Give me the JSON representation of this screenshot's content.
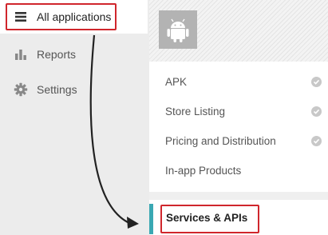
{
  "sidebar": {
    "all_applications": {
      "label": "All applications",
      "icon": "menu-icon"
    },
    "reports": {
      "label": "Reports",
      "icon": "bar-chart-icon"
    },
    "settings": {
      "label": "Settings",
      "icon": "gear-icon"
    }
  },
  "app": {
    "icon": "android-icon"
  },
  "menu": {
    "items": [
      {
        "label": "APK",
        "status_icon": "check-circle-icon"
      },
      {
        "label": "Store Listing",
        "status_icon": "check-circle-icon"
      },
      {
        "label": "Pricing and Distribution",
        "status_icon": "check-circle-icon"
      },
      {
        "label": "In-app Products"
      }
    ],
    "selected": {
      "label": "Services & APIs"
    }
  },
  "colors": {
    "highlight_box": "#d0262c",
    "selected_bar": "#3aa8b3",
    "sidebar_bg": "#ececec"
  }
}
